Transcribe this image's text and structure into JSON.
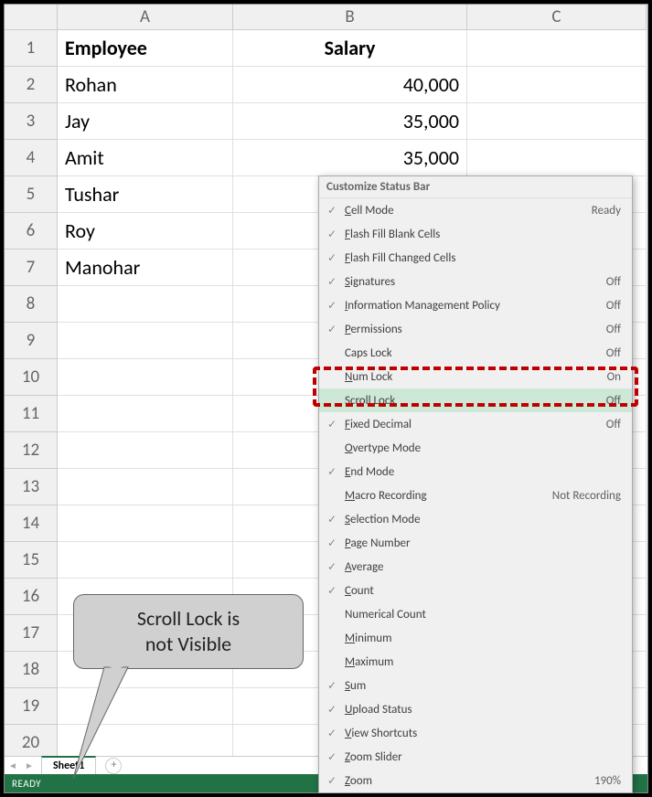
{
  "columns": {
    "A": "A",
    "B": "B",
    "C": "C"
  },
  "headers": {
    "employee": "Employee",
    "salary": "Salary"
  },
  "rows": [
    {
      "n": "1",
      "a": "Employee",
      "b": "Salary",
      "hdr": true
    },
    {
      "n": "2",
      "a": "Rohan",
      "b": "40,000"
    },
    {
      "n": "3",
      "a": "Jay",
      "b": "35,000"
    },
    {
      "n": "4",
      "a": "Amit",
      "b": "35,000"
    },
    {
      "n": "5",
      "a": "Tushar",
      "b": ""
    },
    {
      "n": "6",
      "a": "Roy",
      "b": ""
    },
    {
      "n": "7",
      "a": "Manohar",
      "b": ""
    },
    {
      "n": "8",
      "a": "",
      "b": ""
    },
    {
      "n": "9",
      "a": "",
      "b": ""
    },
    {
      "n": "10",
      "a": "",
      "b": ""
    },
    {
      "n": "11",
      "a": "",
      "b": ""
    },
    {
      "n": "12",
      "a": "",
      "b": ""
    },
    {
      "n": "13",
      "a": "",
      "b": ""
    },
    {
      "n": "14",
      "a": "",
      "b": ""
    },
    {
      "n": "15",
      "a": "",
      "b": ""
    },
    {
      "n": "16",
      "a": "",
      "b": ""
    },
    {
      "n": "17",
      "a": "",
      "b": ""
    },
    {
      "n": "18",
      "a": "",
      "b": ""
    },
    {
      "n": "19",
      "a": "",
      "b": ""
    },
    {
      "n": "20",
      "a": "",
      "b": ""
    }
  ],
  "sheet_tab": "Sheet1",
  "status_ready": "READY",
  "context_menu": {
    "title": "Customize Status Bar",
    "items": [
      {
        "checked": true,
        "label": "Cell Mode",
        "u": "C",
        "status": "Ready"
      },
      {
        "checked": true,
        "label": "Flash Fill Blank Cells",
        "u": "F",
        "status": ""
      },
      {
        "checked": true,
        "label": "Flash Fill Changed Cells",
        "u": "F",
        "status": ""
      },
      {
        "checked": true,
        "label": "Signatures",
        "u": "Si",
        "status": "Off"
      },
      {
        "checked": true,
        "label": "Information Management Policy",
        "u": "I",
        "status": "Off"
      },
      {
        "checked": true,
        "label": "Permissions",
        "u": "P",
        "status": "Off"
      },
      {
        "checked": false,
        "label": "Caps Lock",
        "u": "",
        "status": "Off"
      },
      {
        "checked": false,
        "label": "Num Lock",
        "u": "N",
        "status": "On"
      },
      {
        "checked": false,
        "label": "Scroll Lock",
        "u": "",
        "status": "Off",
        "highlight": true
      },
      {
        "checked": true,
        "label": "Fixed Decimal",
        "u": "Fi",
        "status": "Off"
      },
      {
        "checked": false,
        "label": "Overtype Mode",
        "u": "O",
        "status": ""
      },
      {
        "checked": true,
        "label": "End Mode",
        "u": "E",
        "status": ""
      },
      {
        "checked": false,
        "label": "Macro Recording",
        "u": "M",
        "status": "Not Recording"
      },
      {
        "checked": true,
        "label": "Selection Mode",
        "u": "Se",
        "status": ""
      },
      {
        "checked": true,
        "label": "Page Number",
        "u": "P",
        "status": ""
      },
      {
        "checked": true,
        "label": "Average",
        "u": "A",
        "status": ""
      },
      {
        "checked": true,
        "label": "Count",
        "u": "C",
        "status": ""
      },
      {
        "checked": false,
        "label": "Numerical Count",
        "u": "",
        "status": ""
      },
      {
        "checked": false,
        "label": "Minimum",
        "u": "Mi",
        "status": ""
      },
      {
        "checked": false,
        "label": "Maximum",
        "u": "Ma",
        "status": ""
      },
      {
        "checked": true,
        "label": "Sum",
        "u": "S",
        "status": ""
      },
      {
        "checked": true,
        "label": "Upload Status",
        "u": "U",
        "status": ""
      },
      {
        "checked": true,
        "label": "View Shortcuts",
        "u": "V",
        "status": ""
      },
      {
        "checked": true,
        "label": "Zoom Slider",
        "u": "Z",
        "status": ""
      },
      {
        "checked": true,
        "label": "Zoom",
        "u": "Z",
        "status": "190%"
      }
    ]
  },
  "callout_line1": "Scroll Lock is",
  "callout_line2": "not Visible",
  "nav_left": "◄",
  "nav_right": "►",
  "add_tab": "+"
}
